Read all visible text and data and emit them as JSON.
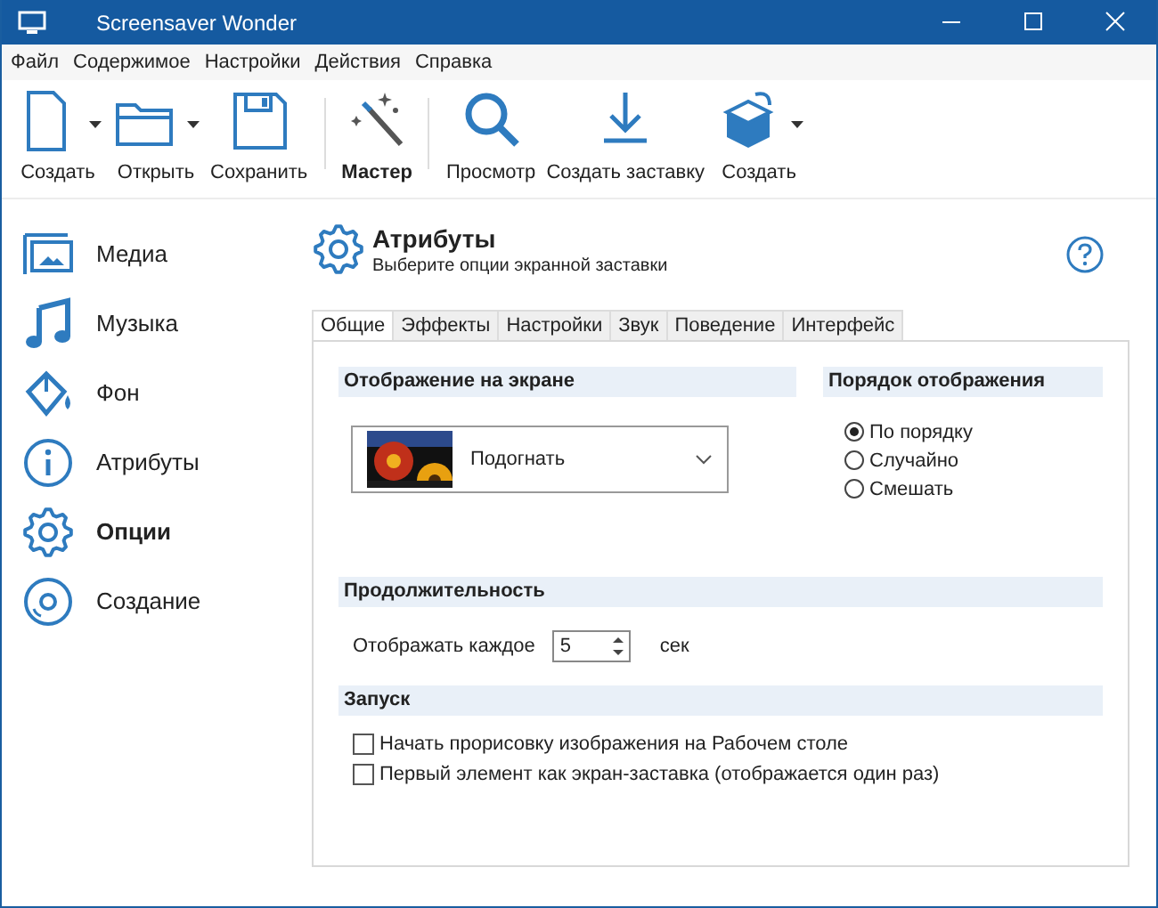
{
  "window": {
    "title": "Screensaver Wonder"
  },
  "menu": [
    "Файл",
    "Содержимое",
    "Настройки",
    "Действия",
    "Справка"
  ],
  "toolbar": [
    {
      "kind": "button",
      "label": "Создать",
      "dropdown": true,
      "bold": false
    },
    {
      "kind": "button",
      "label": "Открыть",
      "dropdown": true,
      "bold": false
    },
    {
      "kind": "button",
      "label": "Сохранить",
      "dropdown": false,
      "bold": false
    },
    {
      "kind": "separator"
    },
    {
      "kind": "button",
      "label": "Мастер",
      "dropdown": false,
      "bold": true
    },
    {
      "kind": "separator"
    },
    {
      "kind": "button",
      "label": "Просмотр",
      "dropdown": false,
      "bold": false
    },
    {
      "kind": "button",
      "label": "Создать заставку",
      "dropdown": false,
      "bold": false
    },
    {
      "kind": "button",
      "label": "Создать",
      "dropdown": true,
      "bold": false
    }
  ],
  "sidebar": {
    "items": [
      {
        "label": "Медиа",
        "selected": false
      },
      {
        "label": "Музыка",
        "selected": false
      },
      {
        "label": "Фон",
        "selected": false
      },
      {
        "label": "Атрибуты",
        "selected": false
      },
      {
        "label": "Опции",
        "selected": true
      },
      {
        "label": "Создание",
        "selected": false
      }
    ]
  },
  "header": {
    "title": "Атрибуты",
    "subtitle": "Выберите опции экранной заставки"
  },
  "tabs": [
    {
      "label": "Общие",
      "selected": true
    },
    {
      "label": "Эффекты",
      "selected": false
    },
    {
      "label": "Настройки",
      "selected": false
    },
    {
      "label": "Звук",
      "selected": false
    },
    {
      "label": "Поведение",
      "selected": false
    },
    {
      "label": "Интерфейс",
      "selected": false
    }
  ],
  "display_section": {
    "title": "Отображение на экране",
    "dropdown": {
      "value": "Подогнать"
    }
  },
  "order_section": {
    "title": "Порядок отображения",
    "options": [
      {
        "label": "По порядку",
        "selected": true
      },
      {
        "label": "Случайно",
        "selected": false
      },
      {
        "label": "Смешать",
        "selected": false
      }
    ]
  },
  "duration_section": {
    "title": "Продолжительность",
    "label": "Отображать каждое",
    "value": "5",
    "unit": "сек"
  },
  "startup_section": {
    "title": "Запуск",
    "options": [
      {
        "label": "Начать прорисовку изображения на Рабочем столе",
        "checked": false
      },
      {
        "label": "Первый элемент как экран-заставка (отображается один раз)",
        "checked": false
      }
    ]
  }
}
